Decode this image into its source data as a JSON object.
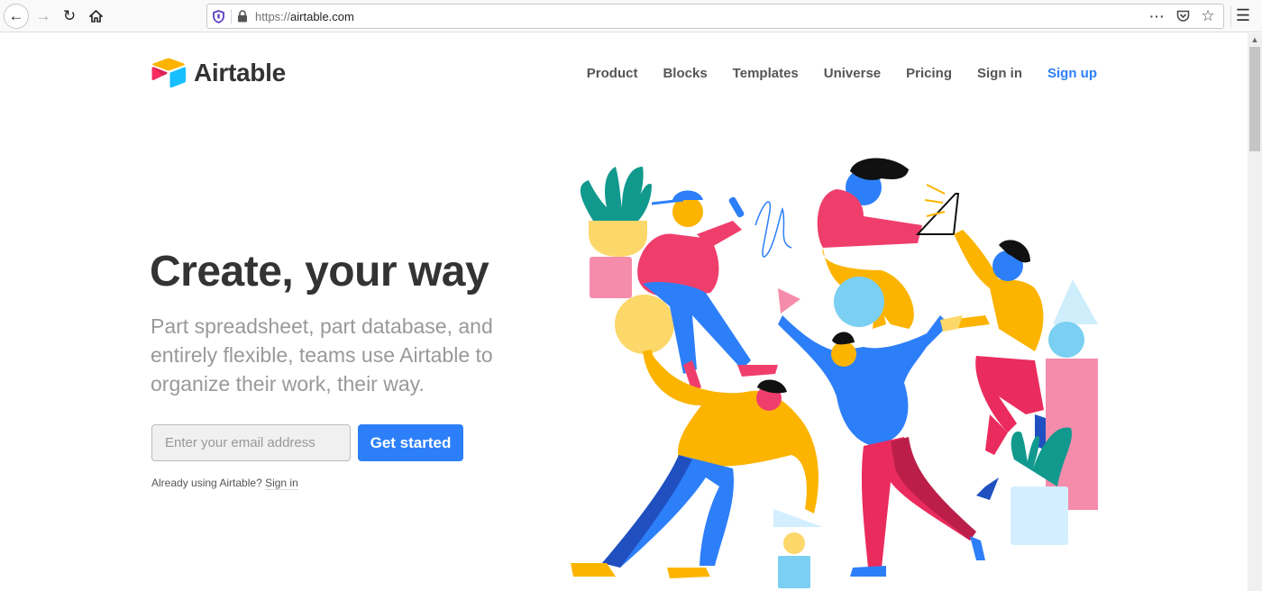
{
  "browser": {
    "url_scheme": "https://",
    "url_host": "airtable.com",
    "icons": [
      "back-icon",
      "forward-icon",
      "reload-icon",
      "home-icon",
      "tracking-shield-icon",
      "lock-icon",
      "more-actions-icon",
      "pocket-icon",
      "bookmark-star-icon",
      "hamburger-menu-icon"
    ]
  },
  "header": {
    "logo_text": "Airtable",
    "nav": [
      {
        "label": "Product"
      },
      {
        "label": "Blocks"
      },
      {
        "label": "Templates"
      },
      {
        "label": "Universe"
      },
      {
        "label": "Pricing"
      },
      {
        "label": "Sign in"
      },
      {
        "label": "Sign up"
      }
    ]
  },
  "hero": {
    "title": "Create, your way",
    "subtitle": "Part spreadsheet, part database, and entirely flexible, teams use Airtable to organize their work, their way.",
    "email_placeholder": "Enter your email address",
    "email_value": "",
    "cta_label": "Get started",
    "already_text": "Already using Airtable? ",
    "signin_link": "Sign in"
  },
  "colors": {
    "brand_blue": "#2d7ff9",
    "logo_yellow": "#fcb400",
    "logo_red": "#f82b60",
    "logo_cyan": "#18bfff"
  }
}
